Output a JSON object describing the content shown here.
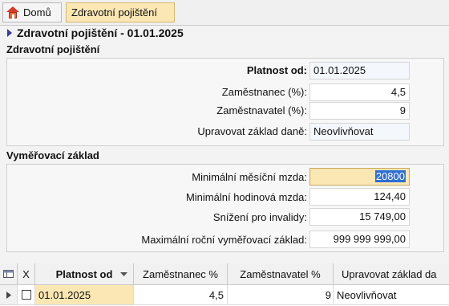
{
  "tabs": {
    "home": "Domů",
    "active": "Zdravotní pojištění"
  },
  "header": {
    "title": "Zdravotní pojištění - 01.01.2025"
  },
  "section1": {
    "title": "Zdravotní pojištění",
    "valid_from_label": "Platnost od:",
    "valid_from_value": "01.01.2025",
    "employee_label": "Zaměstnanec (%):",
    "employee_value": "4,5",
    "employer_label": "Zaměstnavatel (%):",
    "employer_value": "9",
    "adjust_label": "Upravovat základ daně:",
    "adjust_value": "Neovlivňovat"
  },
  "section2": {
    "title": "Vyměřovací základ",
    "min_monthly_label": "Minimální měsíční mzda:",
    "min_monthly_value": "20800",
    "min_hourly_label": "Minimální hodinová mzda:",
    "min_hourly_value": "124,40",
    "disabled_label": "Snížení pro invalidy:",
    "disabled_value": "15 749,00",
    "max_annual_label": "Maximální roční vyměřovací základ:",
    "max_annual_value": "999 999 999,00"
  },
  "grid": {
    "headers": {
      "x": "X",
      "valid_from": "Platnost od",
      "employee": "Zaměstnanec %",
      "employer": "Zaměstnavatel %",
      "adjust": "Upravovat základ da"
    },
    "row": {
      "valid_from": "01.01.2025",
      "employee": "4,5",
      "employer": "9",
      "adjust": "Neovlivňovat"
    }
  },
  "colors": {
    "active_tab": "#fbe7b3",
    "selection": "#2f6fd0",
    "header_arrow": "#3a3a9a"
  },
  "icons": [
    "home-icon",
    "grid-options-icon",
    "row-pointer-icon",
    "sort-down-icon"
  ]
}
